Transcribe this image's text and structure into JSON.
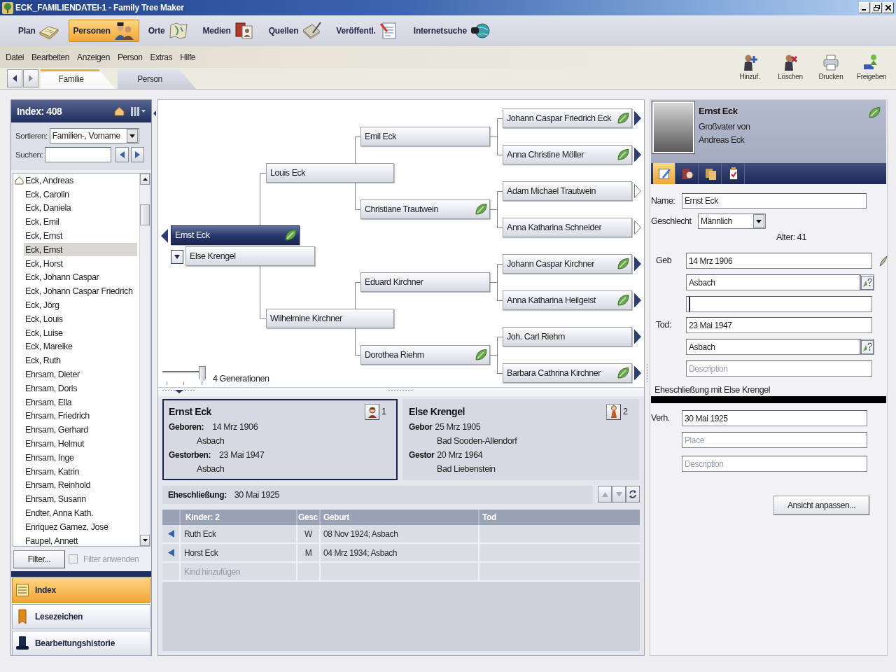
{
  "window": {
    "title": "ECK_FAMILIENDATEI-1 - Family Tree Maker"
  },
  "workspaces": [
    {
      "label": "Plan",
      "selected": false
    },
    {
      "label": "Personen",
      "selected": true
    },
    {
      "label": "Orte",
      "selected": false
    },
    {
      "label": "Medien",
      "selected": false
    },
    {
      "label": "Quellen",
      "selected": false
    },
    {
      "label": "Veröffentl.",
      "selected": false
    },
    {
      "label": "Internetsuche",
      "selected": false
    }
  ],
  "menu": [
    "Datei",
    "Bearbeiten",
    "Anzeigen",
    "Person",
    "Extras",
    "Hilfe"
  ],
  "actions": [
    "Hinzuf.",
    "Löschen",
    "Drucken",
    "Freigeben"
  ],
  "view_tabs": [
    {
      "label": "Familie",
      "selected": true
    },
    {
      "label": "Person",
      "selected": false
    }
  ],
  "index_panel": {
    "title": "Index: 408",
    "sort_label": "Sortieren:",
    "sort_value": "Familien-, Vorname",
    "search_label": "Suchen:",
    "people": [
      {
        "name": "Eck, Andreas",
        "home": true,
        "selected": false
      },
      {
        "name": "Eck, Carolin",
        "home": false,
        "selected": false
      },
      {
        "name": "Eck, Daniela",
        "home": false,
        "selected": false
      },
      {
        "name": "Eck, Emil",
        "home": false,
        "selected": false
      },
      {
        "name": "Eck, Ernst",
        "home": false,
        "selected": false
      },
      {
        "name": "Eck, Ernst",
        "home": false,
        "selected": true
      },
      {
        "name": "Eck, Horst",
        "home": false,
        "selected": false
      },
      {
        "name": "Eck, Johann Caspar",
        "home": false,
        "selected": false
      },
      {
        "name": "Eck, Johann Caspar Friedrich",
        "home": false,
        "selected": false
      },
      {
        "name": "Eck, Jörg",
        "home": false,
        "selected": false
      },
      {
        "name": "Eck, Louis",
        "home": false,
        "selected": false
      },
      {
        "name": "Eck, Luise",
        "home": false,
        "selected": false
      },
      {
        "name": "Eck, Mareike",
        "home": false,
        "selected": false
      },
      {
        "name": "Eck, Ruth",
        "home": false,
        "selected": false
      },
      {
        "name": "Ehrsam, Dieter",
        "home": false,
        "selected": false
      },
      {
        "name": "Ehrsam, Doris",
        "home": false,
        "selected": false
      },
      {
        "name": "Ehrsam, Ella",
        "home": false,
        "selected": false
      },
      {
        "name": "Ehrsam, Friedrich",
        "home": false,
        "selected": false
      },
      {
        "name": "Ehrsam, Gerhard",
        "home": false,
        "selected": false
      },
      {
        "name": "Ehrsam, Helmut",
        "home": false,
        "selected": false
      },
      {
        "name": "Ehrsam, Inge",
        "home": false,
        "selected": false
      },
      {
        "name": "Ehrsam, Katrin",
        "home": false,
        "selected": false
      },
      {
        "name": "Ehrsam, Reinhold",
        "home": false,
        "selected": false
      },
      {
        "name": "Ehrsam, Susann",
        "home": false,
        "selected": false
      },
      {
        "name": "Endter, Anna Kath.",
        "home": false,
        "selected": false
      },
      {
        "name": "Enriquez Gamez, Jose",
        "home": false,
        "selected": false
      },
      {
        "name": "Faupel, Annett",
        "home": false,
        "selected": false
      }
    ],
    "filter_button": "Filter...",
    "filter_checkbox": {
      "label": "Filter anwenden",
      "checked": false,
      "disabled": true
    }
  },
  "side_nav": [
    {
      "label": "Index",
      "selected": true
    },
    {
      "label": "Lesezeichen",
      "selected": false
    },
    {
      "label": "Bearbeitungshistorie",
      "selected": false
    }
  ],
  "pedigree": {
    "person": {
      "name": "Ernst Eck",
      "selected": true,
      "hint": true,
      "children_arrow": true,
      "parents": [
        {
          "name": "Louis Eck",
          "selected": false,
          "hint": false,
          "parents": [
            {
              "name": "Emil Eck",
              "selected": false,
              "hint": false,
              "parents": [
                {
                  "name": "Johann Caspar Friedrich Eck",
                  "selected": false,
                  "hint": true,
                  "more_ancestors": true
                },
                {
                  "name": "Anna Christine Möller",
                  "selected": false,
                  "hint": true,
                  "more_ancestors": true
                }
              ]
            },
            {
              "name": "Christiane Trautwein",
              "selected": false,
              "hint": true,
              "parents": [
                {
                  "name": "Adam Michael Trautwein",
                  "selected": false,
                  "hint": false,
                  "more_ancestors": false
                },
                {
                  "name": "Anna Katharina Schneider",
                  "selected": false,
                  "hint": false,
                  "more_ancestors": false
                }
              ]
            }
          ]
        },
        {
          "name": "Wilhelmine Kirchner",
          "selected": false,
          "hint": false,
          "parents": [
            {
              "name": "Eduard Kirchner",
              "selected": false,
              "hint": false,
              "parents": [
                {
                  "name": "Johann Caspar Kirchner",
                  "selected": false,
                  "hint": true,
                  "more_ancestors": true
                },
                {
                  "name": "Anna Katharina Heilgeist",
                  "selected": false,
                  "hint": true,
                  "more_ancestors": true
                }
              ]
            },
            {
              "name": "Dorothea Riehm",
              "selected": false,
              "hint": true,
              "parents": [
                {
                  "name": "Joh. Carl Riehm",
                  "selected": false,
                  "hint": false,
                  "more_ancestors": true
                },
                {
                  "name": "Barbara Cathrina Kirchner",
                  "selected": false,
                  "hint": true,
                  "more_ancestors": true
                }
              ]
            }
          ]
        }
      ]
    },
    "spouse": {
      "name": "Else Krengel",
      "selected": false,
      "hint": false
    }
  },
  "generations": {
    "label": "4 Generationen",
    "level": 1
  },
  "family": {
    "partners": [
      {
        "name": "Ernst Eck",
        "kind": "man",
        "selected": true,
        "number": "1",
        "events": [
          {
            "label": "Geboren:",
            "date": "14 Mrz 1906",
            "place": "Asbach"
          },
          {
            "label": "Gestorben:",
            "date": "23 Mai 1947",
            "place": "Asbach"
          }
        ]
      },
      {
        "name": "Else Krengel",
        "kind": "woman",
        "selected": false,
        "number": "2",
        "events": [
          {
            "label": "Gebor",
            "date": "25 Mrz 1905",
            "place": "Bad Sooden-Allendorf"
          },
          {
            "label": "Gestor",
            "date": "20 Mrz 1964",
            "place": "Bad Liebenstein"
          }
        ]
      }
    ],
    "marriage": {
      "label": "Eheschließung:",
      "date": "30 Mai 1925"
    },
    "children": {
      "columns": [
        "Kinder: 2",
        "Gesc",
        "Geburt",
        "Tod"
      ],
      "rows": [
        {
          "name": "Ruth Eck",
          "sex": "W",
          "birth": "08 Nov 1924; Asbach"
        },
        {
          "name": "Horst Eck",
          "sex": "M",
          "birth": "04 Mrz 1934; Asbach"
        }
      ],
      "add_row": "Kind hinzufügen"
    }
  },
  "person_editor": {
    "name": "Ernst Eck",
    "hint": true,
    "relation": "Großvater von Andreas Eck",
    "tabs": [
      {
        "selected": true
      },
      {
        "selected": false
      },
      {
        "selected": false
      },
      {
        "selected": false
      }
    ],
    "name_field": {
      "label": "Name:",
      "value": "Ernst Eck"
    },
    "sex_field": {
      "label": "Geschlecht",
      "value": "Männlich"
    },
    "age": "Alter: 41",
    "birth": {
      "label": "Geb",
      "date": "14 Mrz 1906",
      "place": "Asbach",
      "citation": true,
      "description_focused": true
    },
    "death": {
      "label": "Tod:",
      "date": "23 Mai 1947",
      "place": "Asbach",
      "description_focused": false,
      "description_placeholder": "Description"
    },
    "marriage_heading": "Eheschließung mit Else Krengel",
    "marriage": {
      "label": "Verh.",
      "date": "30 Mai 1925",
      "place_placeholder": "Place",
      "description_placeholder": "Description"
    },
    "customize_button": "Ansicht anpassen..."
  }
}
